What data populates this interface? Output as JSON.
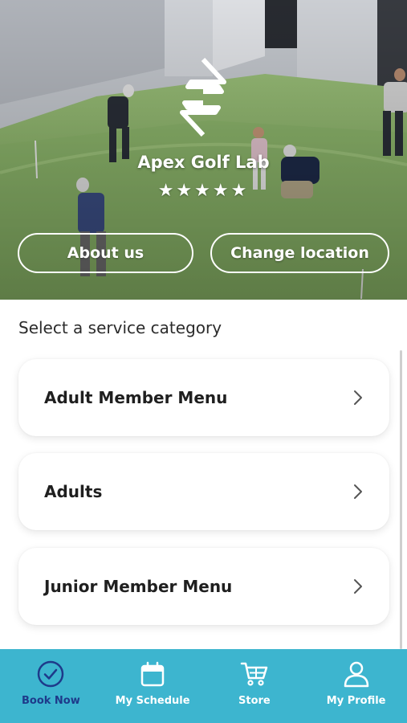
{
  "hero": {
    "venue_name": "Apex Golf Lab",
    "rating_stars": "★★★★★",
    "about_label": "About us",
    "change_location_label": "Change location"
  },
  "services": {
    "title": "Select a service category",
    "items": [
      {
        "label": "Adult Member Menu"
      },
      {
        "label": "Adults"
      },
      {
        "label": "Junior Member Menu"
      }
    ]
  },
  "tabbar": {
    "tabs": [
      {
        "label": "Book Now",
        "icon": "check-circle-icon",
        "active": true
      },
      {
        "label": "My Schedule",
        "icon": "calendar-icon",
        "active": false
      },
      {
        "label": "Store",
        "icon": "cart-icon",
        "active": false
      },
      {
        "label": "My Profile",
        "icon": "person-icon",
        "active": false
      }
    ],
    "colors": {
      "background": "#3db5cf",
      "active": "#1e3a8a",
      "inactive": "#ffffff"
    }
  }
}
